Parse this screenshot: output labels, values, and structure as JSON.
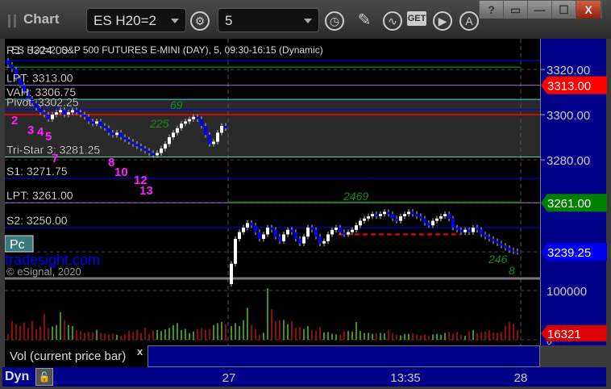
{
  "window": {
    "title": "Chart",
    "buttons": [
      "?",
      "▭",
      "—",
      "☐",
      "X"
    ]
  },
  "toolbar": {
    "symbol": "ES H20=2",
    "interval": "5",
    "get_label": "GET",
    "icons": [
      "gear-icon",
      "clock-icon",
      "pencil-icon",
      "chart-studies-icon",
      "get-icon",
      "play-icon",
      "alert-icon"
    ]
  },
  "chart_data": {
    "type": "candlestick",
    "title": "ES H20=2, S&P 500 FUTURES E-MINI (DAY), 5, 09:30-16:15 (Dynamic)",
    "ylim": [
      3220,
      3335
    ],
    "y_ticks": [
      "3320.00",
      "3300.00",
      "3280.00"
    ],
    "x_ticks": [
      "27",
      "13:35",
      "28"
    ],
    "days": [
      {
        "closes": [
          3322,
          3320,
          3316,
          3313,
          3310,
          3307,
          3305,
          3303,
          3301,
          3300,
          3298,
          3300,
          3301,
          3302,
          3300,
          3301,
          3302,
          3301,
          3300,
          3299,
          3297,
          3296,
          3297,
          3295,
          3294,
          3292,
          3291,
          3292,
          3290,
          3289,
          3288,
          3287,
          3286,
          3285,
          3284,
          3283,
          3282,
          3283,
          3285,
          3287,
          3290,
          3292,
          3294,
          3296,
          3297,
          3298,
          3299,
          3298,
          3295,
          3291,
          3287,
          3288,
          3292,
          3295,
          3294
        ],
        "first_open": 3324
      },
      {
        "closes": [
          3234,
          3245,
          3248,
          3250,
          3252,
          3251,
          3248,
          3245,
          3247,
          3250,
          3249,
          3246,
          3244,
          3247,
          3249,
          3248,
          3245,
          3243,
          3246,
          3250,
          3249,
          3246,
          3243,
          3244,
          3247,
          3249,
          3250,
          3248,
          3247,
          3248,
          3249,
          3251,
          3253,
          3254,
          3255,
          3256,
          3255,
          3256,
          3257,
          3256,
          3254,
          3253,
          3255,
          3256,
          3257,
          3256,
          3255,
          3254,
          3252,
          3251,
          3253,
          3254,
          3255,
          3256,
          3254,
          3250,
          3249,
          3248,
          3249,
          3248,
          3250,
          3249,
          3247,
          3246,
          3245,
          3244,
          3243,
          3242,
          3241,
          3240,
          3239.5,
          3239.25
        ],
        "first_open": 3225
      }
    ],
    "levels": [
      {
        "label": "R1: 3324.00",
        "value": 3324,
        "color": "#0000ff"
      },
      {
        "label": "LPT: 3313.00",
        "value": 3313,
        "color": "#a070d0"
      },
      {
        "label": "VAH: 3306.75",
        "value": 3306.75,
        "color": "#40e0e0"
      },
      {
        "label": "Pivot: 3302.25",
        "value": 3302.25,
        "color": "#0000ff"
      },
      {
        "label": "Tri-Star 3: 3281.25",
        "value": 3281.25,
        "color": "#40e0a0"
      },
      {
        "label": "S1: 3271.75",
        "value": 3271.75,
        "color": "#0000ff"
      },
      {
        "label": "LPT: 3261.00",
        "value": 3261,
        "color": "#a070d0"
      },
      {
        "label": "S2: 3250.00",
        "value": 3250,
        "color": "#0000ff"
      }
    ],
    "extra_lines": [
      {
        "value": 3321,
        "color": "#008000"
      },
      {
        "value": 3300,
        "color": "#ff0000"
      },
      {
        "value": 3261.3,
        "color": "#008000"
      },
      {
        "value": 3247,
        "color": "#ff0000",
        "dashed": true
      }
    ],
    "count_labels": [
      "2",
      "3",
      "4",
      "5",
      "7",
      "8",
      "10",
      "12",
      "13"
    ],
    "last_price_labels": [
      {
        "text": "3313.00",
        "value": 3313,
        "bg": "#ff0000"
      },
      {
        "text": "3261.00",
        "value": 3261,
        "bg": "#008000"
      },
      {
        "text": "3239.25",
        "value": 3239.25,
        "bg": "#0000ee"
      }
    ],
    "volume": {
      "label": "Vol (current price bar)",
      "ticks": [
        "100000",
        "0"
      ],
      "ylim": [
        0,
        100000
      ],
      "last": "16321",
      "last_value": 16321,
      "values": [
        12000,
        38000,
        32000,
        28000,
        35000,
        24000,
        38000,
        22000,
        27000,
        52000,
        24000,
        27000,
        30000,
        56000,
        40000,
        30000,
        28000,
        20000,
        18000,
        14000,
        16000,
        15000,
        20000,
        14000,
        12000,
        11000,
        12000,
        10000,
        8000,
        11000,
        18000,
        16000,
        20000,
        14000,
        25000,
        12000,
        19000,
        20000,
        18000,
        21000,
        24000,
        30000,
        34000,
        20000,
        22000,
        14000,
        17000,
        22000,
        24000,
        20000,
        22000,
        30000,
        34000,
        36000,
        32000,
        28000,
        34000,
        28000,
        40000,
        65000,
        30000,
        22000,
        10000,
        14000,
        105000,
        62000,
        38000,
        40000,
        40000,
        32000,
        38000,
        24000,
        26000,
        22000,
        28000,
        20000,
        19000,
        26000,
        15000,
        16000,
        12000,
        11000,
        10000,
        17000,
        18000,
        17000,
        36000,
        18000,
        14000,
        14000,
        12000,
        13000,
        14000,
        13000,
        20000,
        14000,
        10000,
        9000,
        12000,
        12000,
        13000,
        10000,
        9000,
        11000,
        9000,
        11000,
        12000,
        10000,
        14000,
        16000,
        13000,
        16000,
        10000,
        8000,
        17000,
        20000,
        14000,
        15000,
        17000,
        19000,
        15000,
        14000,
        16000,
        28000,
        36000,
        32000,
        20000,
        18000,
        16321
      ]
    }
  },
  "overlay": {
    "pc_button": "Pc",
    "brand": "tradesight.com",
    "copyright": "© eSignal, 2020"
  },
  "volume_pane": {
    "label": "Vol (current price bar)",
    "close": "x"
  },
  "footer": {
    "dyn": "Dyn"
  },
  "colors": {
    "up": "#ffffff",
    "down": "#0000ff",
    "vol_up": "#66dd22",
    "vol_down": "#dd1111",
    "axis_bg": "#000088"
  }
}
